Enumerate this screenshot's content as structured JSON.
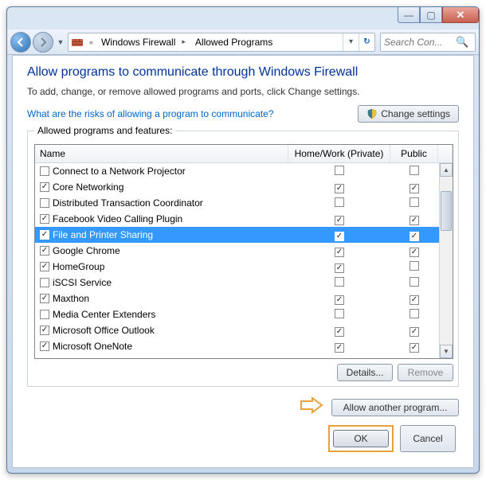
{
  "window": {
    "title": ""
  },
  "nav": {
    "back_tip": "Back",
    "fwd_tip": "Forward",
    "crumbs": [
      "Windows Firewall",
      "Allowed Programs"
    ],
    "refresh_tip": "Refresh",
    "search_placeholder": "Search Con..."
  },
  "page": {
    "heading": "Allow programs to communicate through Windows Firewall",
    "subtext": "To add, change, or remove allowed programs and ports, click Change settings.",
    "risk_link": "What are the risks of allowing a program to communicate?",
    "change_settings": "Change settings",
    "group_label": "Allowed programs and features:",
    "columns": {
      "name": "Name",
      "homework": "Home/Work (Private)",
      "public": "Public"
    },
    "details": "Details...",
    "remove": "Remove",
    "allow_another": "Allow another program...",
    "ok": "OK",
    "cancel": "Cancel"
  },
  "programs": [
    {
      "name": "Connect to a Network Projector",
      "enabled": false,
      "hw": false,
      "pub": false,
      "sel": false
    },
    {
      "name": "Core Networking",
      "enabled": true,
      "hw": true,
      "pub": true,
      "sel": false
    },
    {
      "name": "Distributed Transaction Coordinator",
      "enabled": false,
      "hw": false,
      "pub": false,
      "sel": false
    },
    {
      "name": "Facebook Video Calling Plugin",
      "enabled": true,
      "hw": true,
      "pub": true,
      "sel": false
    },
    {
      "name": "File and Printer Sharing",
      "enabled": true,
      "hw": true,
      "pub": true,
      "sel": true
    },
    {
      "name": "Google Chrome",
      "enabled": true,
      "hw": true,
      "pub": true,
      "sel": false
    },
    {
      "name": "HomeGroup",
      "enabled": true,
      "hw": true,
      "pub": false,
      "sel": false
    },
    {
      "name": "iSCSI Service",
      "enabled": false,
      "hw": false,
      "pub": false,
      "sel": false
    },
    {
      "name": "Maxthon",
      "enabled": true,
      "hw": true,
      "pub": true,
      "sel": false
    },
    {
      "name": "Media Center Extenders",
      "enabled": false,
      "hw": false,
      "pub": false,
      "sel": false
    },
    {
      "name": "Microsoft Office Outlook",
      "enabled": true,
      "hw": true,
      "pub": true,
      "sel": false
    },
    {
      "name": "Microsoft OneNote",
      "enabled": true,
      "hw": true,
      "pub": true,
      "sel": false
    }
  ]
}
